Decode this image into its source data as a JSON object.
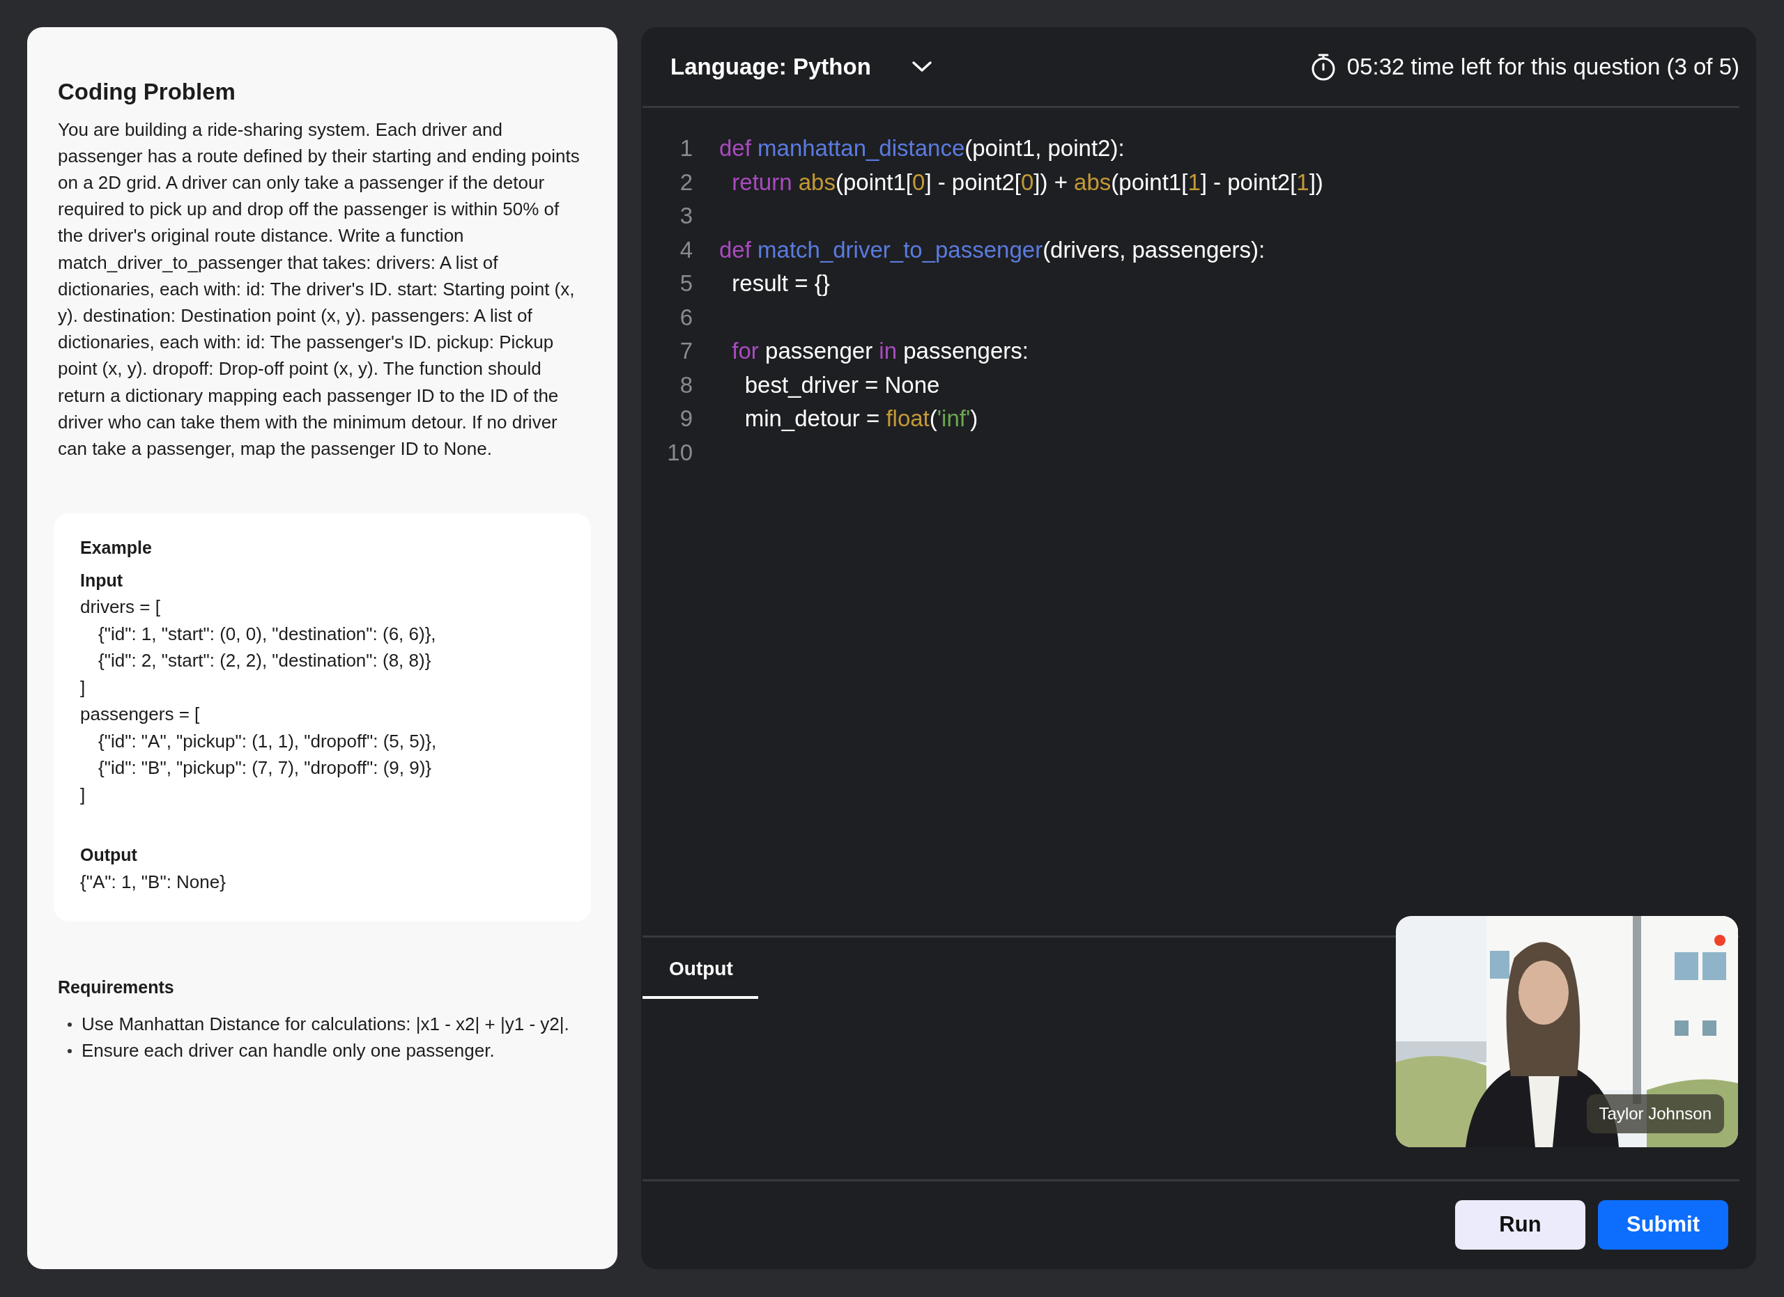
{
  "problem": {
    "title": "Coding Problem",
    "description": "You are building a ride-sharing system. Each driver and passenger has a route defined by their starting and ending points on a 2D grid. A driver can only take a passenger if the detour required to pick up and drop off the passenger is within 50% of the driver's original route distance. Write a function match_driver_to_passenger that takes: drivers: A list of dictionaries, each with: id: The driver's ID. start: Starting point (x, y). destination: Destination point (x, y). passengers: A list of dictionaries, each with: id: The passenger's ID. pickup: Pickup point (x, y). dropoff: Drop-off point (x, y). The function should return a dictionary mapping each passenger ID to the ID of the driver who can take them with the minimum detour. If no driver can take a passenger, map the passenger ID to None.",
    "example": {
      "title": "Example",
      "input_label": "Input",
      "blocks": [
        {
          "open": "drivers = [",
          "items": [
            "{\"id\": 1, \"start\": (0, 0), \"destination\": (6, 6)},",
            "{\"id\": 2, \"start\": (2, 2), \"destination\": (8, 8)}"
          ],
          "close": "]"
        },
        {
          "open": "passengers = [",
          "items": [
            "{\"id\": \"A\", \"pickup\": (1, 1), \"dropoff\": (5, 5)},",
            "{\"id\": \"B\", \"pickup\": (7, 7), \"dropoff\": (9, 9)}"
          ],
          "close": "]"
        }
      ],
      "output_label": "Output",
      "output": "{\"A\": 1, \"B\": None}"
    },
    "requirements": {
      "title": "Requirements",
      "items": [
        "Use Manhattan Distance for calculations: |x1 - x2| + |y1 - y2|.",
        "Ensure each driver can handle only one passenger."
      ]
    }
  },
  "editor": {
    "language": "Language: Python",
    "timer": "05:32 time left for this question (3 of 5)",
    "lines": [
      {
        "number": "1",
        "tokens": [
          {
            "text": "def ",
            "kind": "keyword"
          },
          {
            "text": "manhattan_distance",
            "kind": "function"
          },
          {
            "text": "(point1, point2):",
            "kind": "plain"
          }
        ]
      },
      {
        "number": "2",
        "tokens": [
          {
            "text": "  return ",
            "kind": "keyword"
          },
          {
            "text": "abs",
            "kind": "builtin"
          },
          {
            "text": "(point1[",
            "kind": "plain"
          },
          {
            "text": "0",
            "kind": "number"
          },
          {
            "text": "] - point2[",
            "kind": "plain"
          },
          {
            "text": "0",
            "kind": "number"
          },
          {
            "text": "]) + ",
            "kind": "plain"
          },
          {
            "text": "abs",
            "kind": "builtin"
          },
          {
            "text": "(point1[",
            "kind": "plain"
          },
          {
            "text": "1",
            "kind": "number"
          },
          {
            "text": "] - point2[",
            "kind": "plain"
          },
          {
            "text": "1",
            "kind": "number"
          },
          {
            "text": "])",
            "kind": "plain"
          }
        ]
      },
      {
        "number": "3"
      },
      {
        "number": "4",
        "tokens": [
          {
            "text": "def ",
            "kind": "keyword"
          },
          {
            "text": "match_driver_to_passenger",
            "kind": "function"
          },
          {
            "text": "(drivers, passengers):",
            "kind": "plain"
          }
        ]
      },
      {
        "number": "5",
        "tokens": [
          {
            "text": "  result = {}",
            "kind": "plain"
          }
        ]
      },
      {
        "number": "6"
      },
      {
        "number": "7",
        "tokens": [
          {
            "text": "  for ",
            "kind": "keyword"
          },
          {
            "text": "passenger ",
            "kind": "plain"
          },
          {
            "text": "in ",
            "kind": "keyword"
          },
          {
            "text": "passengers:",
            "kind": "plain"
          }
        ]
      },
      {
        "number": "8",
        "tokens": [
          {
            "text": "    best_driver = None",
            "kind": "plain"
          }
        ]
      },
      {
        "number": "9",
        "tokens": [
          {
            "text": "    min_detour = ",
            "kind": "plain"
          },
          {
            "text": "float",
            "kind": "builtin"
          },
          {
            "text": "(",
            "kind": "plain"
          },
          {
            "text": "'inf'",
            "kind": "string"
          },
          {
            "text": ")",
            "kind": "plain"
          }
        ]
      },
      {
        "number": "10"
      }
    ]
  },
  "output_panel": {
    "tabs": [
      {
        "label": "Output",
        "selected": true
      }
    ]
  },
  "video": {
    "kind": "picture",
    "name": "Taylor Johnson",
    "recording": true
  },
  "buttons": [
    {
      "label": "Run",
      "kind": "secondary"
    },
    {
      "label": "Submit",
      "kind": "primary"
    }
  ]
}
